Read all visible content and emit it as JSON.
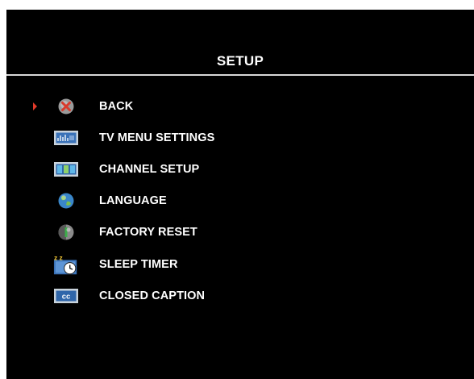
{
  "menu": {
    "title": "SETUP",
    "selected_index": 0,
    "items": [
      {
        "label": "BACK",
        "icon": "back-icon"
      },
      {
        "label": "TV MENU SETTINGS",
        "icon": "tv-menu-settings-icon"
      },
      {
        "label": "CHANNEL SETUP",
        "icon": "channel-setup-icon"
      },
      {
        "label": "LANGUAGE",
        "icon": "language-icon"
      },
      {
        "label": "FACTORY RESET",
        "icon": "factory-reset-icon"
      },
      {
        "label": "SLEEP TIMER",
        "icon": "sleep-timer-icon",
        "icon_text": "z z"
      },
      {
        "label": "CLOSED CAPTION",
        "icon": "closed-caption-icon",
        "icon_text": "cc"
      }
    ]
  },
  "colors": {
    "background": "#000000",
    "text": "#ffffff",
    "cursor": "#e23a2a",
    "icon_blue": "#3a72b8"
  }
}
